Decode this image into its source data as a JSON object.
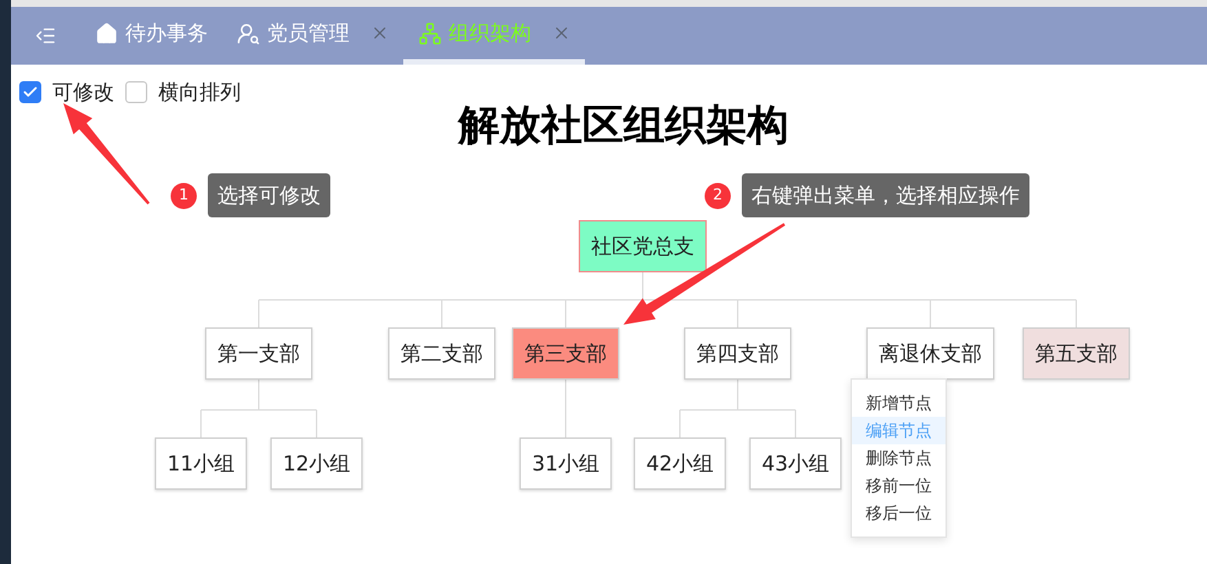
{
  "tabs": [
    {
      "label": "待办事务",
      "closable": false,
      "selected": false
    },
    {
      "label": "党员管理",
      "closable": true,
      "selected": false
    },
    {
      "label": "组织架构",
      "closable": true,
      "selected": true
    }
  ],
  "options": [
    {
      "label": "可修改",
      "checked": true
    },
    {
      "label": "横向排列",
      "checked": false
    }
  ],
  "title": "解放社区组织架构",
  "hints": [
    {
      "badge": "1",
      "text": "选择可修改"
    },
    {
      "badge": "2",
      "text": "右键弹出菜单，选择相应操作"
    }
  ],
  "org_chart": {
    "label": "社区党总支",
    "color": "#7dfcc4",
    "children": [
      {
        "label": "第一支部",
        "color": "#ffffff",
        "children": [
          {
            "label": "11小组",
            "color": "#ffffff"
          },
          {
            "label": "12小组",
            "color": "#ffffff"
          }
        ]
      },
      {
        "label": "第二支部",
        "color": "#ffffff"
      },
      {
        "label": "第三支部",
        "color": "#fb8b7f",
        "children": [
          {
            "label": "31小组",
            "color": "#ffffff"
          }
        ]
      },
      {
        "label": "第四支部",
        "color": "#ffffff",
        "children": [
          {
            "label": "42小组",
            "color": "#ffffff"
          },
          {
            "label": "43小组",
            "color": "#ffffff"
          }
        ]
      },
      {
        "label": "离退休支部",
        "color": "#ffffff"
      },
      {
        "label": "第五支部",
        "color": "#f0dede"
      }
    ]
  },
  "context_menu": [
    {
      "label": "新增节点",
      "selected": false
    },
    {
      "label": "编辑节点",
      "selected": true
    },
    {
      "label": "删除节点",
      "selected": false
    },
    {
      "label": "移前一位",
      "selected": false
    },
    {
      "label": "移后一位",
      "selected": false
    }
  ]
}
